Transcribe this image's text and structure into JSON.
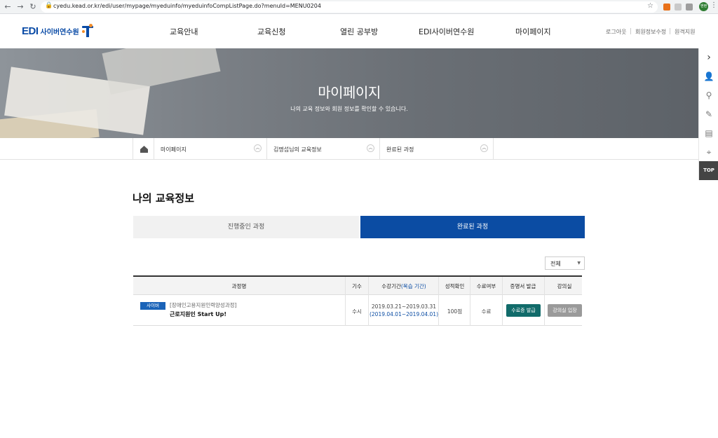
{
  "browser": {
    "url": "cyedu.kead.or.kr/edi/user/mypage/myeduinfo/myeduinfoCompListPage.do?menuId=MENU0204",
    "back_icon": "arrow-left-icon",
    "forward_icon": "arrow-right-icon",
    "reload_icon": "reload-icon",
    "profile_label": "엔텐"
  },
  "logo": {
    "edi": "EDI",
    "sub": "사이버연수원"
  },
  "gnb": [
    "교육안내",
    "교육신청",
    "열린 공부방",
    "EDI사이버연수원",
    "마이페이지"
  ],
  "util": [
    "로그아웃",
    "회원정보수정",
    "원격지원"
  ],
  "hero": {
    "title": "마이페이지",
    "subtitle": "나의 교육 정보와 회원 정보를 확인할 수 있습니다."
  },
  "quick": {
    "top_label": "TOP"
  },
  "breadcrumb": [
    "마이페이지",
    "김명섭님의 교육정보",
    "완료된 과정"
  ],
  "page_title": "나의 교육정보",
  "tabs": {
    "in_progress": "진행중인 과정",
    "completed": "완료된 과정"
  },
  "filter": {
    "selected": "전체"
  },
  "table": {
    "headers": {
      "course": "과정명",
      "term": "기수",
      "period_a": "수강기간",
      "period_b": "(복습 기간)",
      "grade": "성적확인",
      "complete": "수료여부",
      "cert": "증명서 발급",
      "room": "강의실"
    },
    "rows": [
      {
        "badge": "사이버",
        "category": "[장애인고용지원인력양성과정]",
        "name": "근로지원인 Start Up!",
        "term": "수시",
        "period": "2019.03.21~2019.03.31",
        "review": "(2019.04.01~2019.04.01)",
        "grade": "100점",
        "complete": "수료",
        "cert_button": "수료증 발급",
        "room_button": "강의실 입장"
      }
    ]
  }
}
